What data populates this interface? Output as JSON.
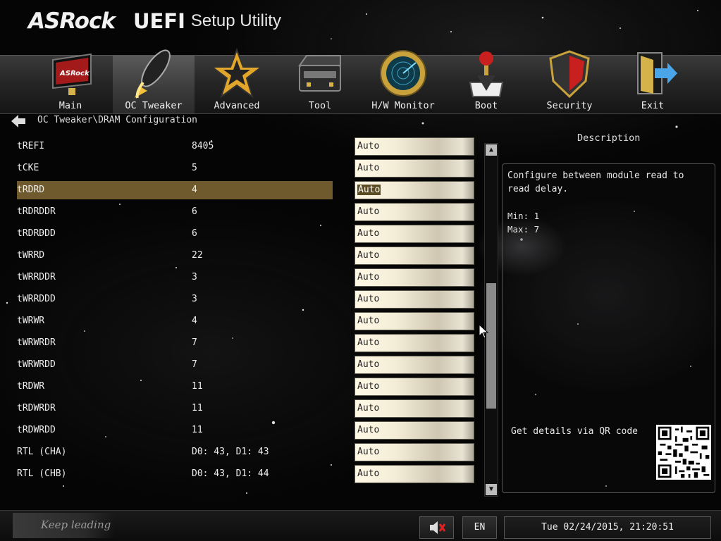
{
  "header": {
    "brand": "ASRock",
    "uefi": "UEFI",
    "subtitle": "Setup Utility"
  },
  "nav": {
    "active": "OC Tweaker",
    "tabs": [
      {
        "label": "Main",
        "icon": "monitor-icon"
      },
      {
        "label": "OC Tweaker",
        "icon": "rocket-icon"
      },
      {
        "label": "Advanced",
        "icon": "star-icon"
      },
      {
        "label": "Tool",
        "icon": "toolbox-icon"
      },
      {
        "label": "H/W Monitor",
        "icon": "radar-icon"
      },
      {
        "label": "Boot",
        "icon": "joystick-icon"
      },
      {
        "label": "Security",
        "icon": "shield-icon"
      },
      {
        "label": "Exit",
        "icon": "exit-door-icon"
      }
    ]
  },
  "breadcrumb": "OC Tweaker\\DRAM Configuration",
  "settings": [
    {
      "name": "tREFI",
      "current": "8405",
      "option": "Auto"
    },
    {
      "name": "tCKE",
      "current": "5",
      "option": "Auto"
    },
    {
      "name": "tRDRD",
      "current": "4",
      "option": "Auto",
      "selected": true
    },
    {
      "name": "tRDRDDR",
      "current": "6",
      "option": "Auto"
    },
    {
      "name": "tRDRDDD",
      "current": "6",
      "option": "Auto"
    },
    {
      "name": "tWRRD",
      "current": "22",
      "option": "Auto"
    },
    {
      "name": "tWRRDDR",
      "current": "3",
      "option": "Auto"
    },
    {
      "name": "tWRRDDD",
      "current": "3",
      "option": "Auto"
    },
    {
      "name": "tWRWR",
      "current": "4",
      "option": "Auto"
    },
    {
      "name": "tWRWRDR",
      "current": "7",
      "option": "Auto"
    },
    {
      "name": "tWRWRDD",
      "current": "7",
      "option": "Auto"
    },
    {
      "name": "tRDWR",
      "current": "11",
      "option": "Auto"
    },
    {
      "name": "tRDWRDR",
      "current": "11",
      "option": "Auto"
    },
    {
      "name": "tRDWRDD",
      "current": "11",
      "option": "Auto"
    },
    {
      "name": "RTL (CHA)",
      "current": "D0: 43, D1: 43",
      "option": "Auto"
    },
    {
      "name": "RTL (CHB)",
      "current": "D0: 43, D1: 44",
      "option": "Auto"
    }
  ],
  "description": {
    "title": "Description",
    "text": "Configure between module read to\nread delay.",
    "min": "Min: 1",
    "max": "Max: 7",
    "qr_label": "Get details via QR code"
  },
  "footer": {
    "slogan": "Keep leading",
    "language": "EN",
    "datetime": "Tue 02/24/2015, 21:20:51"
  },
  "colors": {
    "selected_row": "#6e5a2c",
    "background": "#050505"
  }
}
